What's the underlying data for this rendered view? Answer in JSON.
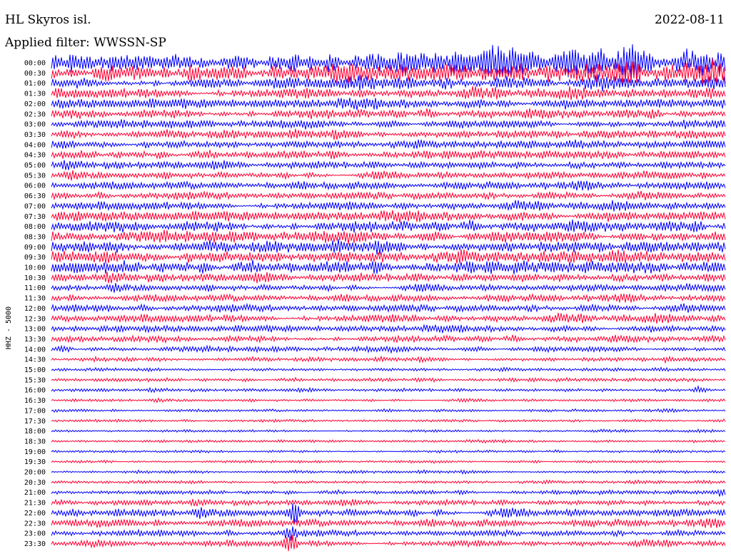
{
  "header": {
    "station": "HL Skyros isl.",
    "date": "2022-08-11",
    "filter_label": "Applied filter: WWSSN-SP"
  },
  "chart_data": {
    "type": "line",
    "title": "HL Skyros isl.",
    "ylabel": "HHZ - 5000",
    "categories": [
      "00:00",
      "00:30",
      "01:00",
      "01:30",
      "02:00",
      "02:30",
      "03:00",
      "03:30",
      "04:00",
      "04:30",
      "05:00",
      "05:30",
      "06:00",
      "06:30",
      "07:00",
      "07:30",
      "08:00",
      "08:30",
      "09:00",
      "09:30",
      "10:00",
      "10:30",
      "11:00",
      "11:30",
      "12:00",
      "12:30",
      "13:00",
      "13:30",
      "14:00",
      "14:30",
      "15:00",
      "15:30",
      "16:00",
      "16:30",
      "17:00",
      "17:30",
      "18:00",
      "18:30",
      "19:00",
      "19:30",
      "20:00",
      "20:30",
      "21:00",
      "21:30",
      "22:00",
      "22:30",
      "23:00",
      "23:30"
    ],
    "trace_colors": [
      "#0000ff",
      "#ff0033"
    ],
    "relative_amplitude": [
      1.0,
      0.85,
      0.55,
      0.5,
      0.45,
      0.42,
      0.38,
      0.4,
      0.38,
      0.36,
      0.34,
      0.34,
      0.36,
      0.36,
      0.4,
      0.45,
      0.5,
      0.55,
      0.55,
      0.6,
      0.55,
      0.4,
      0.33,
      0.33,
      0.36,
      0.38,
      0.3,
      0.3,
      0.26,
      0.2,
      0.16,
      0.16,
      0.15,
      0.14,
      0.13,
      0.13,
      0.12,
      0.12,
      0.12,
      0.12,
      0.14,
      0.15,
      0.18,
      0.25,
      0.4,
      0.35,
      0.3,
      0.3
    ],
    "events": [
      {
        "row": "16:00",
        "x_fraction": 0.96,
        "amplitude": 1.0
      },
      {
        "row": "22:00",
        "x_fraction": 0.36,
        "amplitude": 1.0
      },
      {
        "row": "23:00",
        "x_fraction": 0.355,
        "amplitude": 1.3
      },
      {
        "row": "23:30",
        "x_fraction": 0.355,
        "amplitude": 1.6
      },
      {
        "row": "21:00",
        "x_fraction": 0.995,
        "amplitude": 0.8
      },
      {
        "row": "20:30",
        "x_fraction": 0.87,
        "amplitude": 0.5
      },
      {
        "row": "19:30",
        "x_fraction": 0.72,
        "amplitude": 0.5
      },
      {
        "row": "14:30",
        "x_fraction": 0.91,
        "amplitude": 0.6
      },
      {
        "row": "15:30",
        "x_fraction": 0.57,
        "amplitude": 0.5
      }
    ]
  }
}
